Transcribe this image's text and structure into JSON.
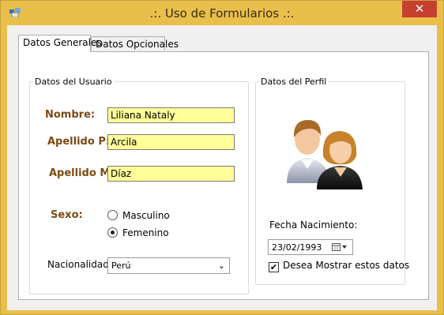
{
  "window": {
    "title": ".:. Uso de Formularios .:.",
    "close_glyph": "✕"
  },
  "tabs": [
    {
      "label": "Datos Generales"
    },
    {
      "label": "Datos Opcionales"
    }
  ],
  "usuario": {
    "legend": "Datos del Usuario",
    "nombre_label": "Nombre:",
    "nombre_value": "Liliana Nataly",
    "apellido_p_label": "Apellido P:",
    "apellido_p_value": "Arcila",
    "apellido_m_label": "Apellido M:",
    "apellido_m_value": "Díaz",
    "sexo_label": "Sexo:",
    "sexo_options": [
      "Masculino",
      "Femenino"
    ],
    "sexo_selected": "Femenino",
    "nacionalidad_label": "Nacionalidad:",
    "nacionalidad_value": "Perú"
  },
  "perfil": {
    "legend": "Datos del Perfil",
    "fecha_label": "Fecha Nacimiento:",
    "fecha_value": "23/02/1993",
    "mostrar_label": "Desea Mostrar estos datos",
    "mostrar_checked": true
  },
  "icons": {
    "app": "form-app-icon",
    "profile": "users-icon",
    "calendar": "calendar-icon",
    "dropdown": "chevron-down-icon"
  },
  "colors": {
    "title_bar": "#e9bf4c",
    "close_button": "#c7402f",
    "field_bg": "#ffff99",
    "label_brown": "#7b4a12"
  }
}
